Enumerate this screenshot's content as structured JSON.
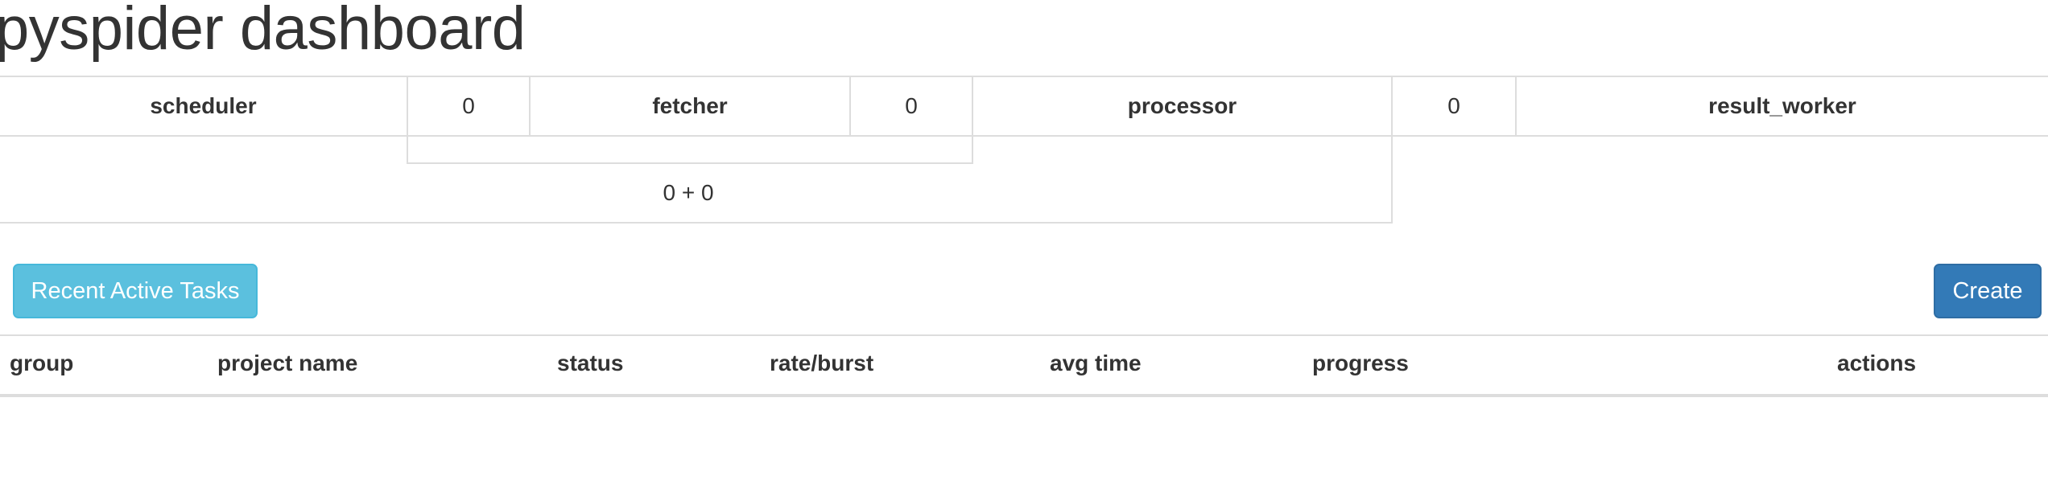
{
  "page": {
    "title": "pyspider dashboard"
  },
  "queues": {
    "scheduler": "scheduler",
    "scheduler_to_fetcher": "0",
    "fetcher": "fetcher",
    "fetcher_to_processor": "0",
    "processor": "processor",
    "processor_to_result": "0",
    "result_worker": "result_worker",
    "new_task_summary": "0 + 0"
  },
  "toolbar": {
    "recent_active_tasks_label": "Recent Active Tasks",
    "create_label": "Create"
  },
  "projects_table": {
    "columns": [
      "group",
      "project name",
      "status",
      "rate/burst",
      "avg time",
      "progress",
      "actions"
    ],
    "rows": []
  },
  "colors": {
    "info_button": "#5bc0de",
    "primary_button": "#337ab7",
    "border": "#dddddd",
    "text": "#333333"
  }
}
